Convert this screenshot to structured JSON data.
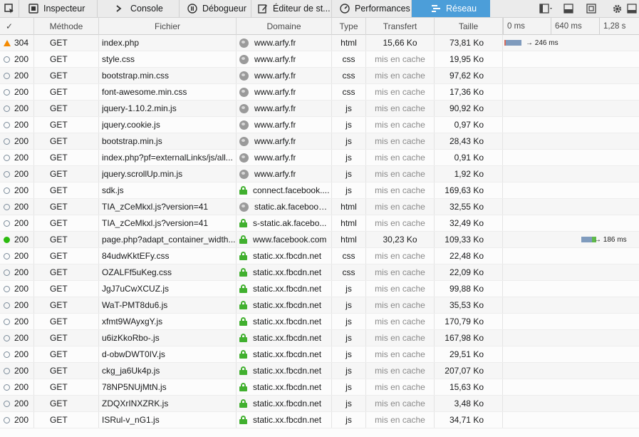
{
  "toolbar": {
    "tabs": [
      {
        "label": "Inspecteur",
        "icon": "inspector-icon"
      },
      {
        "label": "Console",
        "icon": "console-icon"
      },
      {
        "label": "Débogueur",
        "icon": "debugger-icon"
      },
      {
        "label": "Éditeur de st...",
        "icon": "style-editor-icon"
      },
      {
        "label": "Performances",
        "icon": "performance-icon"
      },
      {
        "label": "Réseau",
        "icon": "network-icon"
      }
    ],
    "selected_tab": "Réseau",
    "accent_color": "#4c9ed9"
  },
  "header": {
    "check": "✓",
    "method": "Méthode",
    "file": "Fichier",
    "domain": "Domaine",
    "type": "Type",
    "transfer": "Transfert",
    "size": "Taille",
    "ticks": [
      "0 ms",
      "640 ms",
      "1,28 s"
    ]
  },
  "requests": [
    {
      "status": "304",
      "method": "GET",
      "file": "index.php",
      "domain": "www.arfy.fr",
      "secure": false,
      "type": "html",
      "transfer": "15,66 Ko",
      "size": "73,81 Ko",
      "indicator": "warning",
      "timing": "→ 246 ms"
    },
    {
      "status": "200",
      "method": "GET",
      "file": "style.css",
      "domain": "www.arfy.fr",
      "secure": false,
      "type": "css",
      "transfer": "mis en cache",
      "size": "19,95 Ko",
      "indicator": "cached"
    },
    {
      "status": "200",
      "method": "GET",
      "file": "bootstrap.min.css",
      "domain": "www.arfy.fr",
      "secure": false,
      "type": "css",
      "transfer": "mis en cache",
      "size": "97,62 Ko",
      "indicator": "cached"
    },
    {
      "status": "200",
      "method": "GET",
      "file": "font-awesome.min.css",
      "domain": "www.arfy.fr",
      "secure": false,
      "type": "css",
      "transfer": "mis en cache",
      "size": "17,36 Ko",
      "indicator": "cached"
    },
    {
      "status": "200",
      "method": "GET",
      "file": "jquery-1.10.2.min.js",
      "domain": "www.arfy.fr",
      "secure": false,
      "type": "js",
      "transfer": "mis en cache",
      "size": "90,92 Ko",
      "indicator": "cached"
    },
    {
      "status": "200",
      "method": "GET",
      "file": "jquery.cookie.js",
      "domain": "www.arfy.fr",
      "secure": false,
      "type": "js",
      "transfer": "mis en cache",
      "size": "0,97 Ko",
      "indicator": "cached"
    },
    {
      "status": "200",
      "method": "GET",
      "file": "bootstrap.min.js",
      "domain": "www.arfy.fr",
      "secure": false,
      "type": "js",
      "transfer": "mis en cache",
      "size": "28,43 Ko",
      "indicator": "cached"
    },
    {
      "status": "200",
      "method": "GET",
      "file": "index.php?pf=externalLinks/js/all...",
      "domain": "www.arfy.fr",
      "secure": false,
      "type": "js",
      "transfer": "mis en cache",
      "size": "0,91 Ko",
      "indicator": "cached"
    },
    {
      "status": "200",
      "method": "GET",
      "file": "jquery.scrollUp.min.js",
      "domain": "www.arfy.fr",
      "secure": false,
      "type": "js",
      "transfer": "mis en cache",
      "size": "1,92 Ko",
      "indicator": "cached"
    },
    {
      "status": "200",
      "method": "GET",
      "file": "sdk.js",
      "domain": "connect.facebook....",
      "secure": true,
      "type": "js",
      "transfer": "mis en cache",
      "size": "169,63 Ko",
      "indicator": "cached"
    },
    {
      "status": "200",
      "method": "GET",
      "file": "TIA_zCeMkxl.js?version=41",
      "domain": "static.ak.facebook....",
      "secure": false,
      "type": "html",
      "transfer": "mis en cache",
      "size": "32,55 Ko",
      "indicator": "cached"
    },
    {
      "status": "200",
      "method": "GET",
      "file": "TIA_zCeMkxl.js?version=41",
      "domain": "s-static.ak.facebo...",
      "secure": true,
      "type": "html",
      "transfer": "mis en cache",
      "size": "32,49 Ko",
      "indicator": "cached"
    },
    {
      "status": "200",
      "method": "GET",
      "file": "page.php?adapt_container_width...",
      "domain": "www.facebook.com",
      "secure": true,
      "type": "html",
      "transfer": "30,23 Ko",
      "size": "109,33 Ko",
      "indicator": "success",
      "timing": "→ 186 ms"
    },
    {
      "status": "200",
      "method": "GET",
      "file": "84udwKktEFy.css",
      "domain": "static.xx.fbcdn.net",
      "secure": true,
      "type": "css",
      "transfer": "mis en cache",
      "size": "22,48 Ko",
      "indicator": "cached"
    },
    {
      "status": "200",
      "method": "GET",
      "file": "OZALFf5uKeg.css",
      "domain": "static.xx.fbcdn.net",
      "secure": true,
      "type": "css",
      "transfer": "mis en cache",
      "size": "22,09 Ko",
      "indicator": "cached"
    },
    {
      "status": "200",
      "method": "GET",
      "file": "JgJ7uCwXCUZ.js",
      "domain": "static.xx.fbcdn.net",
      "secure": true,
      "type": "js",
      "transfer": "mis en cache",
      "size": "99,88 Ko",
      "indicator": "cached"
    },
    {
      "status": "200",
      "method": "GET",
      "file": "WaT-PMT8du6.js",
      "domain": "static.xx.fbcdn.net",
      "secure": true,
      "type": "js",
      "transfer": "mis en cache",
      "size": "35,53 Ko",
      "indicator": "cached"
    },
    {
      "status": "200",
      "method": "GET",
      "file": "xfmt9WAyxgY.js",
      "domain": "static.xx.fbcdn.net",
      "secure": true,
      "type": "js",
      "transfer": "mis en cache",
      "size": "170,79 Ko",
      "indicator": "cached"
    },
    {
      "status": "200",
      "method": "GET",
      "file": "u6izKkoRbo-.js",
      "domain": "static.xx.fbcdn.net",
      "secure": true,
      "type": "js",
      "transfer": "mis en cache",
      "size": "167,98 Ko",
      "indicator": "cached"
    },
    {
      "status": "200",
      "method": "GET",
      "file": "d-obwDWT0IV.js",
      "domain": "static.xx.fbcdn.net",
      "secure": true,
      "type": "js",
      "transfer": "mis en cache",
      "size": "29,51 Ko",
      "indicator": "cached"
    },
    {
      "status": "200",
      "method": "GET",
      "file": "ckg_ja6Uk4p.js",
      "domain": "static.xx.fbcdn.net",
      "secure": true,
      "type": "js",
      "transfer": "mis en cache",
      "size": "207,07 Ko",
      "indicator": "cached"
    },
    {
      "status": "200",
      "method": "GET",
      "file": "78NP5NUjMtN.js",
      "domain": "static.xx.fbcdn.net",
      "secure": true,
      "type": "js",
      "transfer": "mis en cache",
      "size": "15,63 Ko",
      "indicator": "cached"
    },
    {
      "status": "200",
      "method": "GET",
      "file": "ZDQXrINXZRK.js",
      "domain": "static.xx.fbcdn.net",
      "secure": true,
      "type": "js",
      "transfer": "mis en cache",
      "size": "3,48 Ko",
      "indicator": "cached"
    },
    {
      "status": "200",
      "method": "GET",
      "file": "ISRul-v_nG1.js",
      "domain": "static.xx.fbcdn.net",
      "secure": true,
      "type": "js",
      "transfer": "mis en cache",
      "size": "34,71 Ko",
      "indicator": "cached"
    }
  ],
  "colors": {
    "warning": "#f48a00",
    "success": "#2cbb0f",
    "secure_lock": "#41b02f",
    "timing_wait": "#7f9bbd",
    "timing_receive": "#5fb94a"
  }
}
